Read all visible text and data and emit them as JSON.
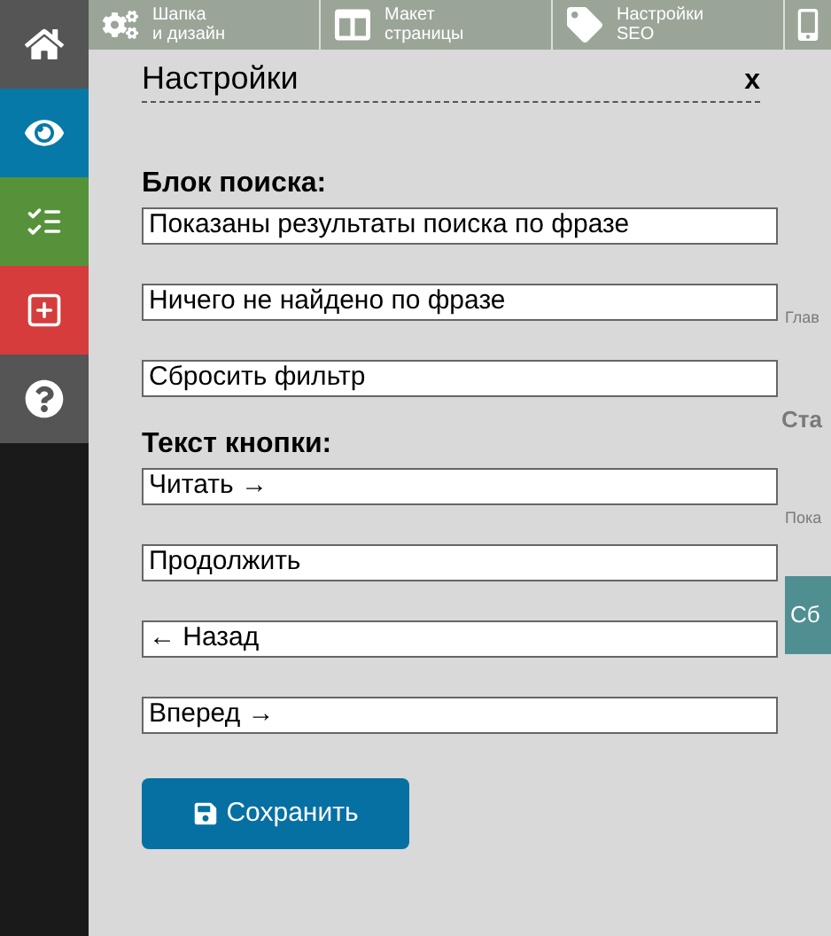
{
  "sidebar": [
    {
      "kind": "home",
      "color": "#555555"
    },
    {
      "kind": "view",
      "color": "#0679a8"
    },
    {
      "kind": "list",
      "color": "#55923a"
    },
    {
      "kind": "add",
      "color": "#d63c3c"
    },
    {
      "kind": "help",
      "color": "#555555"
    }
  ],
  "toolbar": [
    {
      "kind": "gears",
      "line1": "Шапка",
      "line2": "и дизайн"
    },
    {
      "kind": "columns",
      "line1": "Макет",
      "line2": "страницы"
    },
    {
      "kind": "tag",
      "line1": "Настройки",
      "line2": "SEO"
    }
  ],
  "background": {
    "crumb": "Глав",
    "heading": "Ста",
    "field": "Пока",
    "button": "Сб"
  },
  "dialog": {
    "title": "Настройки",
    "close": "x",
    "sections": [
      {
        "heading": "Блок поиска:",
        "fields": [
          "Показаны результаты поиска по фразе",
          "Ничего не найдено по фразе",
          "Сбросить фильтр"
        ]
      },
      {
        "heading": "Текст кнопки:",
        "fields": [
          "Читать →",
          "Продолжить",
          "← Назад",
          "Вперед →"
        ]
      }
    ],
    "save": "Сохранить"
  }
}
